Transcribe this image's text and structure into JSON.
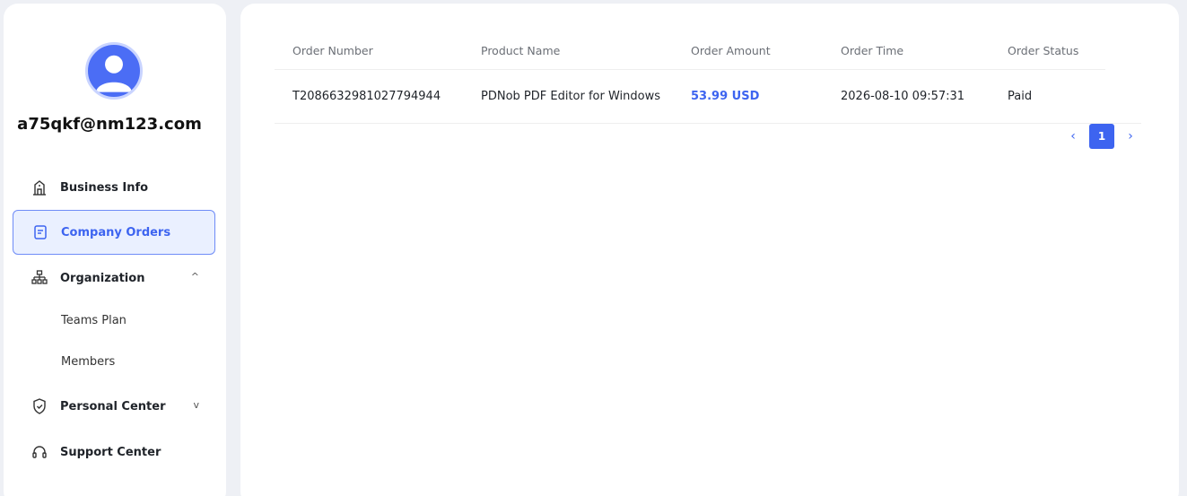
{
  "user": {
    "email": "a75qkf@nm123.com"
  },
  "sidebar": {
    "items": [
      {
        "label": "Business Info",
        "icon": "building-icon"
      },
      {
        "label": "Company Orders",
        "icon": "document-icon",
        "active": true
      },
      {
        "label": "Organization",
        "icon": "org-chart-icon",
        "expanded": true
      },
      {
        "label": "Personal Center",
        "icon": "shield-check-icon",
        "expanded": false
      },
      {
        "label": "Support Center",
        "icon": "headset-icon"
      }
    ],
    "sub_items": [
      "Teams Plan",
      "Members"
    ]
  },
  "orders": {
    "columns": [
      "Order Number",
      "Product Name",
      "Order Amount",
      "Order Time",
      "Order Status"
    ],
    "rows": [
      {
        "number": "T2086632981027794944",
        "product": "PDNob PDF Editor for Windows",
        "amount": "53.99 USD",
        "time": "2026-08-10 09:57:31",
        "status": "Paid"
      }
    ]
  },
  "pagination": {
    "current": "1"
  },
  "colors": {
    "accent": "#3d64f0",
    "active_bg": "#eaf0ff"
  }
}
